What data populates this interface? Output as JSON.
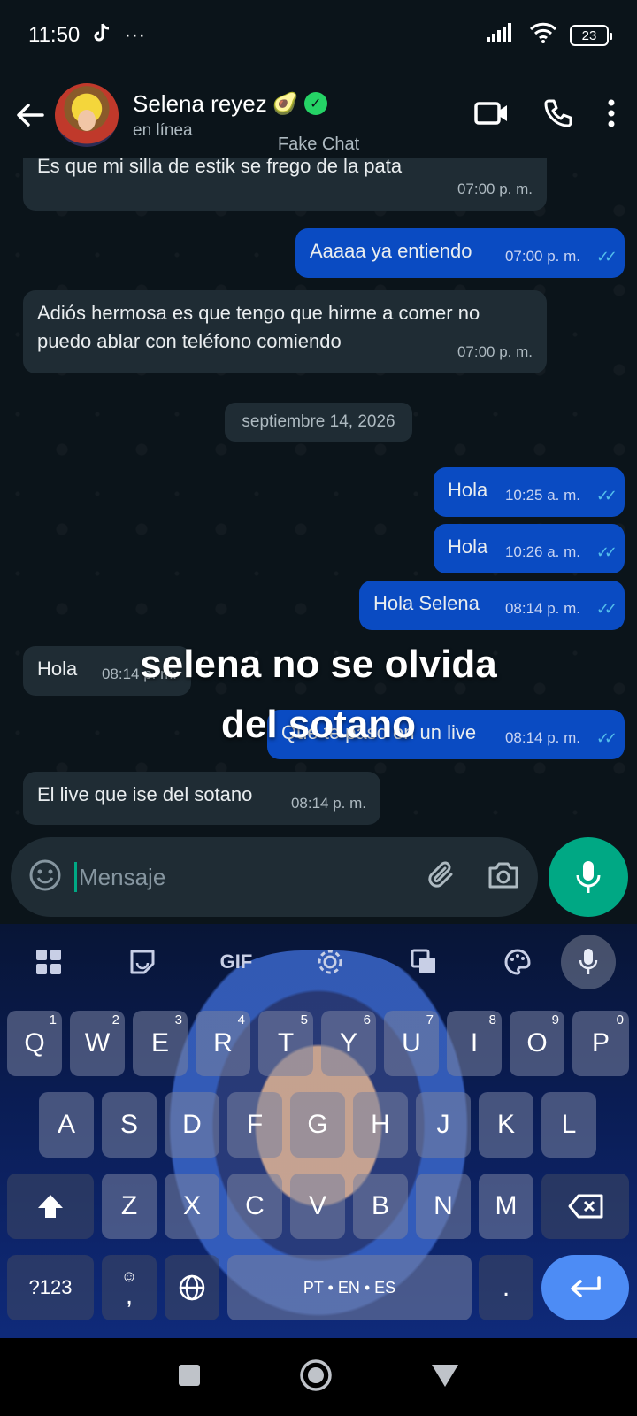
{
  "status_bar": {
    "time": "11:50",
    "extra": "···",
    "battery": "23"
  },
  "header": {
    "contact_name": "Selena reyez",
    "name_emoji": "🥑",
    "status": "en línea",
    "overlay_label": "Fake Chat"
  },
  "messages": [
    {
      "dir": "in",
      "text": "Es que mi silla  de estik se frego de la pata",
      "time": "07:00 p. m."
    },
    {
      "dir": "out",
      "text": "Aaaaa ya entiendo",
      "time": "07:00 p. m."
    },
    {
      "dir": "in",
      "text": "Adiós hermosa es que tengo que hirme a comer no puedo ablar con teléfono comiendo",
      "time": "07:00 p. m."
    },
    {
      "dir": "out",
      "text": "Hola",
      "time": "10:25 a. m."
    },
    {
      "dir": "out",
      "text": "Hola",
      "time": "10:26 a. m."
    },
    {
      "dir": "out",
      "text": "Hola Selena",
      "time": "08:14 p. m."
    },
    {
      "dir": "in",
      "text": "Hola",
      "time": "08:14 p. m."
    },
    {
      "dir": "out",
      "text": "Que te paso en un live",
      "time": "08:14 p. m."
    },
    {
      "dir": "in",
      "text": "El live que ise del sotano",
      "time": "08:14 p. m."
    }
  ],
  "date_separator": "septiembre 14, 2026",
  "caption": {
    "line1": "selena no se olvida",
    "line2": "del sotano"
  },
  "composer": {
    "placeholder": "Mensaje"
  },
  "keyboard": {
    "toolbar_gif": "GIF",
    "row1": [
      [
        "Q",
        "1"
      ],
      [
        "W",
        "2"
      ],
      [
        "E",
        "3"
      ],
      [
        "R",
        "4"
      ],
      [
        "T",
        "5"
      ],
      [
        "Y",
        "6"
      ],
      [
        "U",
        "7"
      ],
      [
        "I",
        "8"
      ],
      [
        "O",
        "9"
      ],
      [
        "P",
        "0"
      ]
    ],
    "row2": [
      "A",
      "S",
      "D",
      "F",
      "G",
      "H",
      "J",
      "K",
      "L"
    ],
    "row3": [
      "Z",
      "X",
      "C",
      "V",
      "B",
      "N",
      "M"
    ],
    "symbols_key": "?123",
    "comma_key": ",",
    "space_label": "PT • EN • ES",
    "period_key": "."
  }
}
